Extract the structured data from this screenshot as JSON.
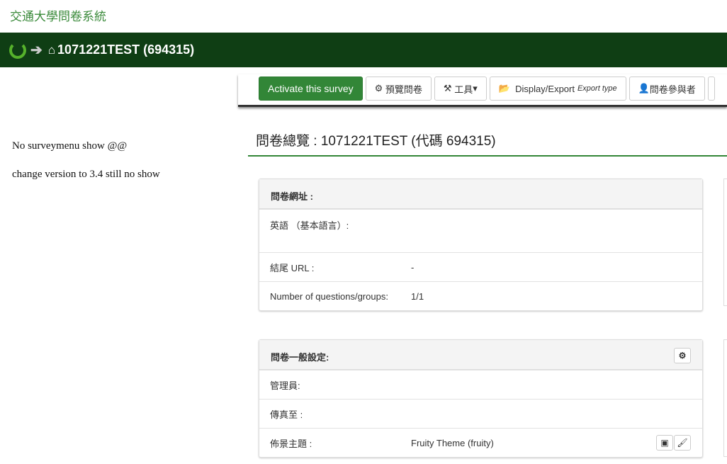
{
  "site_title": "交通大學問卷系統",
  "navbar": {
    "survey_title": "1071221TEST (694315)"
  },
  "toolbar": {
    "activate": "Activate this survey",
    "preview": "預覽問卷",
    "tools": "工具",
    "display_export": "Display/Export",
    "export_type": "Export type",
    "participants": "問卷參與者"
  },
  "notes": [
    "No surveymenu  show @@",
    "change version to 3.4 still no show"
  ],
  "page_title": "問卷總覽 : 1071221TEST (代碼 694315)",
  "url_panel": {
    "title": "問卷網址 :",
    "rows": [
      {
        "label": "英語 （基本語言）:",
        "value": ""
      },
      {
        "label": "結尾 URL :",
        "value": "-"
      },
      {
        "label": "Number of questions/groups:",
        "value": "1/1"
      }
    ]
  },
  "general_panel": {
    "title": "問卷一般設定:",
    "rows": [
      {
        "label": "管理員:",
        "value": ""
      },
      {
        "label": "傳真至 :",
        "value": ""
      },
      {
        "label": "佈景主題 :",
        "value": "Fruity Theme (fruity)"
      }
    ]
  }
}
